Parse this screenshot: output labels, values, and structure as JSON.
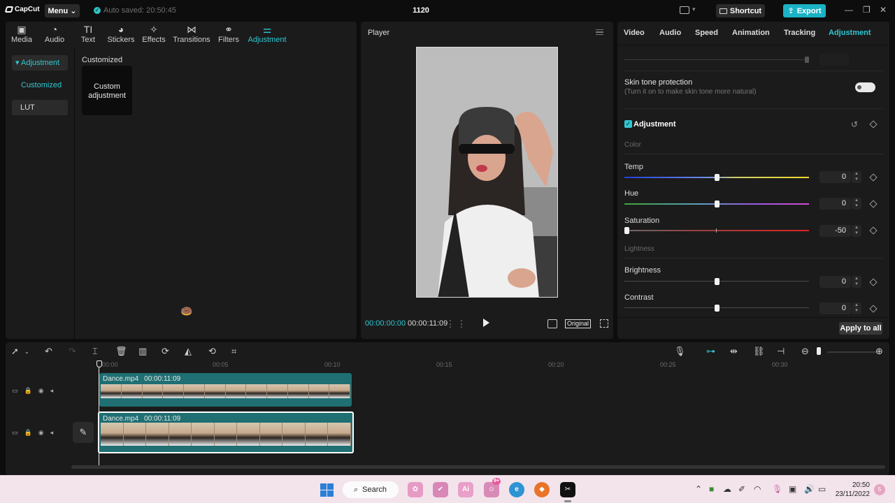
{
  "titlebar": {
    "logo": "CapCut",
    "menu": "Menu",
    "autosave": "Auto saved: 20:50:45",
    "project_title": "1120",
    "shortcut": "Shortcut",
    "export": "Export"
  },
  "media_tabs": [
    {
      "label": "Media",
      "icon": "media-icon"
    },
    {
      "label": "Audio",
      "icon": "audio-icon"
    },
    {
      "label": "Text",
      "icon": "text-icon"
    },
    {
      "label": "Stickers",
      "icon": "stickers-icon"
    },
    {
      "label": "Effects",
      "icon": "effects-icon"
    },
    {
      "label": "Transitions",
      "icon": "transitions-icon"
    },
    {
      "label": "Filters",
      "icon": "filters-icon"
    },
    {
      "label": "Adjustment",
      "icon": "adjustment-icon"
    }
  ],
  "side_nav": {
    "adjustment": "Adjustment",
    "customized": "Customized",
    "lut": "LUT"
  },
  "library": {
    "section": "Customized",
    "card": "Custom adjustment"
  },
  "player": {
    "title": "Player",
    "current_time": "00:00:00:00",
    "total_time": "00:00:11:09",
    "ratio": "Original"
  },
  "inspector": {
    "tabs": [
      "Video",
      "Audio",
      "Speed",
      "Animation",
      "Tracking",
      "Adjustment"
    ],
    "active_tab": "Adjustment",
    "skin_tone_title": "Skin tone protection",
    "skin_tone_sub": "(Turn it on to make skin tone more natural)",
    "adjustment_title": "Adjustment",
    "color_group": "Color",
    "lightness_group": "Lightness",
    "rows": [
      {
        "label": "Temp",
        "value": "0",
        "level": 0.5
      },
      {
        "label": "Hue",
        "value": "0",
        "level": 0.5
      },
      {
        "label": "Saturation",
        "value": "-50",
        "level": 0.0
      },
      {
        "label": "Brightness",
        "value": "0",
        "level": 0.5
      },
      {
        "label": "Contrast",
        "value": "0",
        "level": 0.5
      }
    ],
    "apply_all": "Apply to all"
  },
  "timeline": {
    "ruler": [
      "00:00",
      "00:05",
      "00:10",
      "00:15",
      "00:20",
      "00:25",
      "00:30"
    ],
    "clips": [
      {
        "name": "Dance.mp4",
        "duration": "00:00:11:09"
      },
      {
        "name": "Dance.mp4",
        "duration": "00:00:11:09"
      }
    ]
  },
  "taskbar": {
    "search": "Search",
    "time": "20:50",
    "date": "23/11/2022",
    "badge": "9+"
  },
  "colors": {
    "accent": "#2fc7d2",
    "export": "#1ab2c4",
    "clip": "#1f6f73"
  }
}
